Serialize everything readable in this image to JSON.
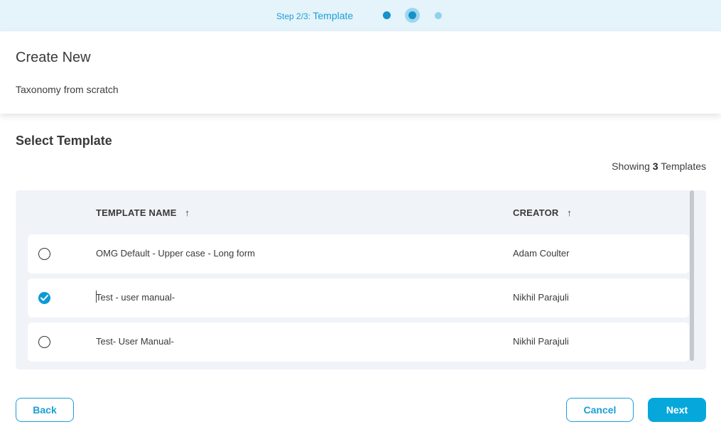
{
  "stepper": {
    "step_label": "Step 2/3:",
    "step_title": "Template",
    "steps": 3,
    "current_step": 2
  },
  "header": {
    "title": "Create New",
    "subtitle": "Taxonomy from scratch"
  },
  "section": {
    "title": "Select Template",
    "showing_prefix": "Showing",
    "showing_count": "3",
    "showing_suffix": "Templates"
  },
  "table": {
    "columns": [
      {
        "label": "TEMPLATE NAME",
        "sort": "ascending"
      },
      {
        "label": "CREATOR",
        "sort": "ascending"
      }
    ],
    "rows": [
      {
        "name": "OMG Default - Upper case - Long form",
        "creator": "Adam Coulter",
        "selected": false
      },
      {
        "name": "Test - user manual-",
        "creator": "Nikhil Parajuli",
        "selected": true
      },
      {
        "name": "Test- User Manual-",
        "creator": "Nikhil Parajuli",
        "selected": false
      }
    ]
  },
  "footer": {
    "back_label": "Back",
    "cancel_label": "Cancel",
    "next_label": "Next"
  },
  "colors": {
    "accent": "#1a9fd6",
    "primary_button": "#06a8dc",
    "stepper_bg": "#e5f3fb",
    "table_bg": "#f0f3f8"
  },
  "icons": {
    "sort": "arrow-up-icon",
    "check": "check-icon"
  }
}
